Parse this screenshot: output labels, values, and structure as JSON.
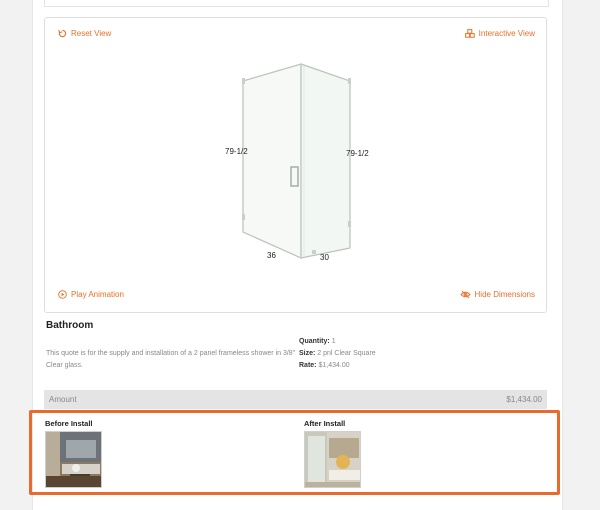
{
  "viewer": {
    "reset_label": "Reset View",
    "interactive_label": "Interactive View",
    "play_label": "Play Animation",
    "hide_dimensions_label": "Hide Dimensions",
    "dimensions": {
      "left_height": "79-1/2",
      "right_height": "79-1/2",
      "bottom_width": "36",
      "bottom_depth": "30"
    }
  },
  "quote": {
    "title": "Bathroom",
    "description": "This quote is for the supply and installation of a 2 panel frameless shower in 3/8\" Clear glass.",
    "quantity_label": "Quantity:",
    "quantity_value": "1",
    "size_label": "Size:",
    "size_value": "2 pnl Clear Square",
    "rate_label": "Rate:",
    "rate_value": "$1,434.00"
  },
  "amount": {
    "label": "Amount",
    "value": "$1,434.00"
  },
  "install": {
    "before_label": "Before Install",
    "after_label": "After Install"
  },
  "colors": {
    "accent": "#e8702a",
    "highlight": "#e96a2c"
  }
}
